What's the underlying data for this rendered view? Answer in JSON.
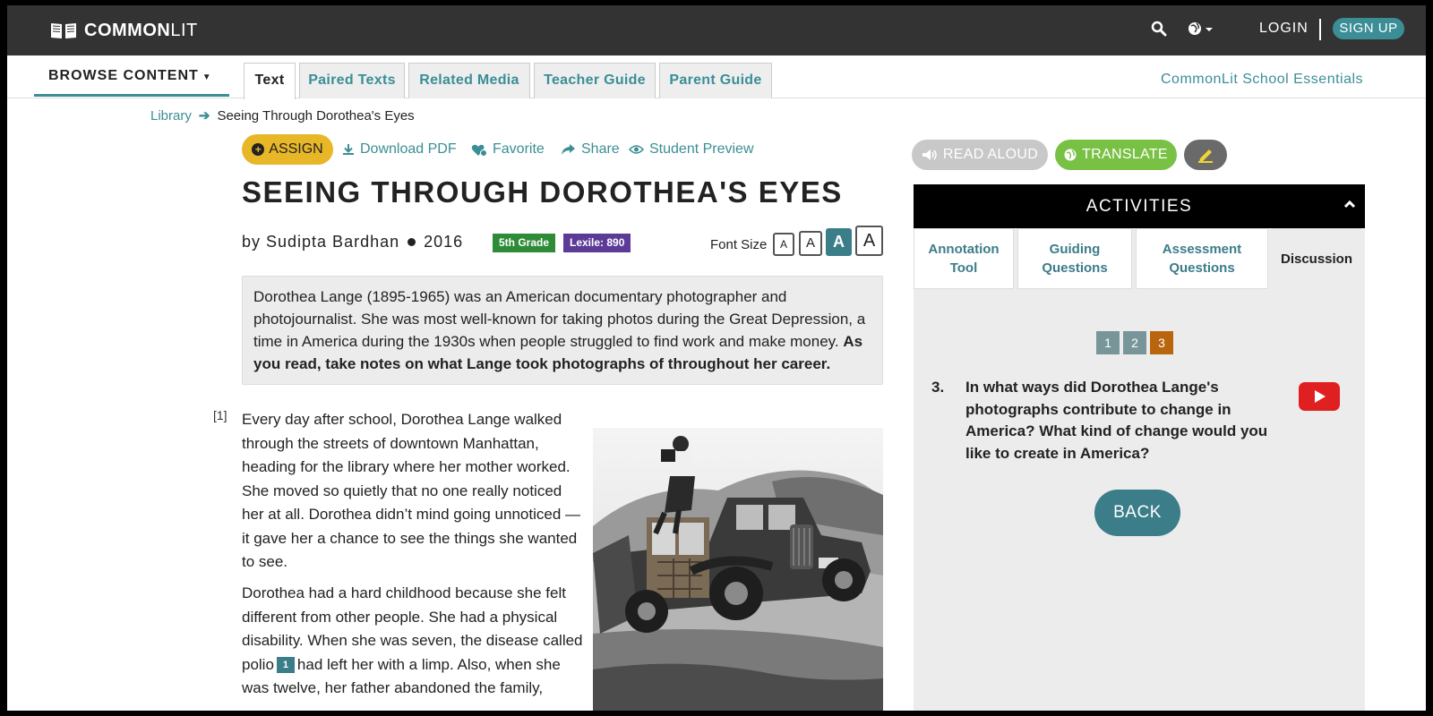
{
  "header": {
    "logo_bold": "COMMON",
    "logo_light": "LIT",
    "login": "LOGIN",
    "signup": "SIGN UP"
  },
  "subnav": {
    "browse": "BROWSE CONTENT",
    "tabs": [
      {
        "label": "Text",
        "active": true
      },
      {
        "label": "Paired Texts",
        "active": false
      },
      {
        "label": "Related Media",
        "active": false
      },
      {
        "label": "Teacher Guide",
        "active": false
      },
      {
        "label": "Parent Guide",
        "active": false
      }
    ],
    "essentials": "CommonLit School Essentials"
  },
  "breadcrumb": {
    "library": "Library",
    "current": "Seeing Through Dorothea's Eyes"
  },
  "actions": {
    "assign": "ASSIGN",
    "download": "Download PDF",
    "favorite": "Favorite",
    "share": "Share",
    "preview": "Student Preview"
  },
  "text": {
    "title": "SEEING THROUGH DOROTHEA'S EYES",
    "author": "by Sudipta Bardhan",
    "year": "2016",
    "grade": "5th Grade",
    "lexile": "Lexile: 890",
    "font_size_label": "Font Size",
    "font_size_options": [
      "A",
      "A",
      "A",
      "A"
    ],
    "font_size_selected_index": 2,
    "intro": "Dorothea Lange (1895-1965) was an American documentary photographer and photojournalist. She was most well-known for taking photos during the Great Depression, a time in America during the 1930s when people struggled to find work and make money.",
    "intro_bold": "As you read, take notes on what Lange took photographs of throughout her career.",
    "para_number": "[1]",
    "para1": "Every day after school, Dorothea Lange walked through the streets of downtown Manhattan, heading for the library where her mother worked. She moved so quietly that no one really noticed her at all. Dorothea didn’t mind going unnoticed — it gave her a chance to see the things she wanted to see.",
    "para2_a": "Dorothea had a hard childhood because she felt different from other people. She had a physical disability. When she was seven, the disease called polio",
    "footnote": "1",
    "para2_b": "had left her with a limp. Also, when she was twelve, her father abandoned the family,"
  },
  "tools": {
    "read_aloud": "READ ALOUD",
    "translate": "TRANSLATE"
  },
  "activities": {
    "heading": "ACTIVITIES",
    "tabs": [
      {
        "label": "Annotation Tool",
        "active": false
      },
      {
        "label": "Guiding Questions",
        "active": false
      },
      {
        "label": "Assessment Questions",
        "active": false
      },
      {
        "label": "Discussion",
        "active": true
      }
    ],
    "pages": [
      "1",
      "2",
      "3"
    ],
    "current_page": "3",
    "question_number": "3.",
    "question": "In what ways did Dorothea Lange's photographs contribute to change in America? What kind of change would you like to create in America?",
    "back": "BACK"
  },
  "colors": {
    "teal": "#3b8e96",
    "assign": "#e8b727",
    "translate": "#79c145",
    "grade_badge": "#2e8b37",
    "lexile_badge": "#5b3b96",
    "current_page": "#b8650e"
  }
}
